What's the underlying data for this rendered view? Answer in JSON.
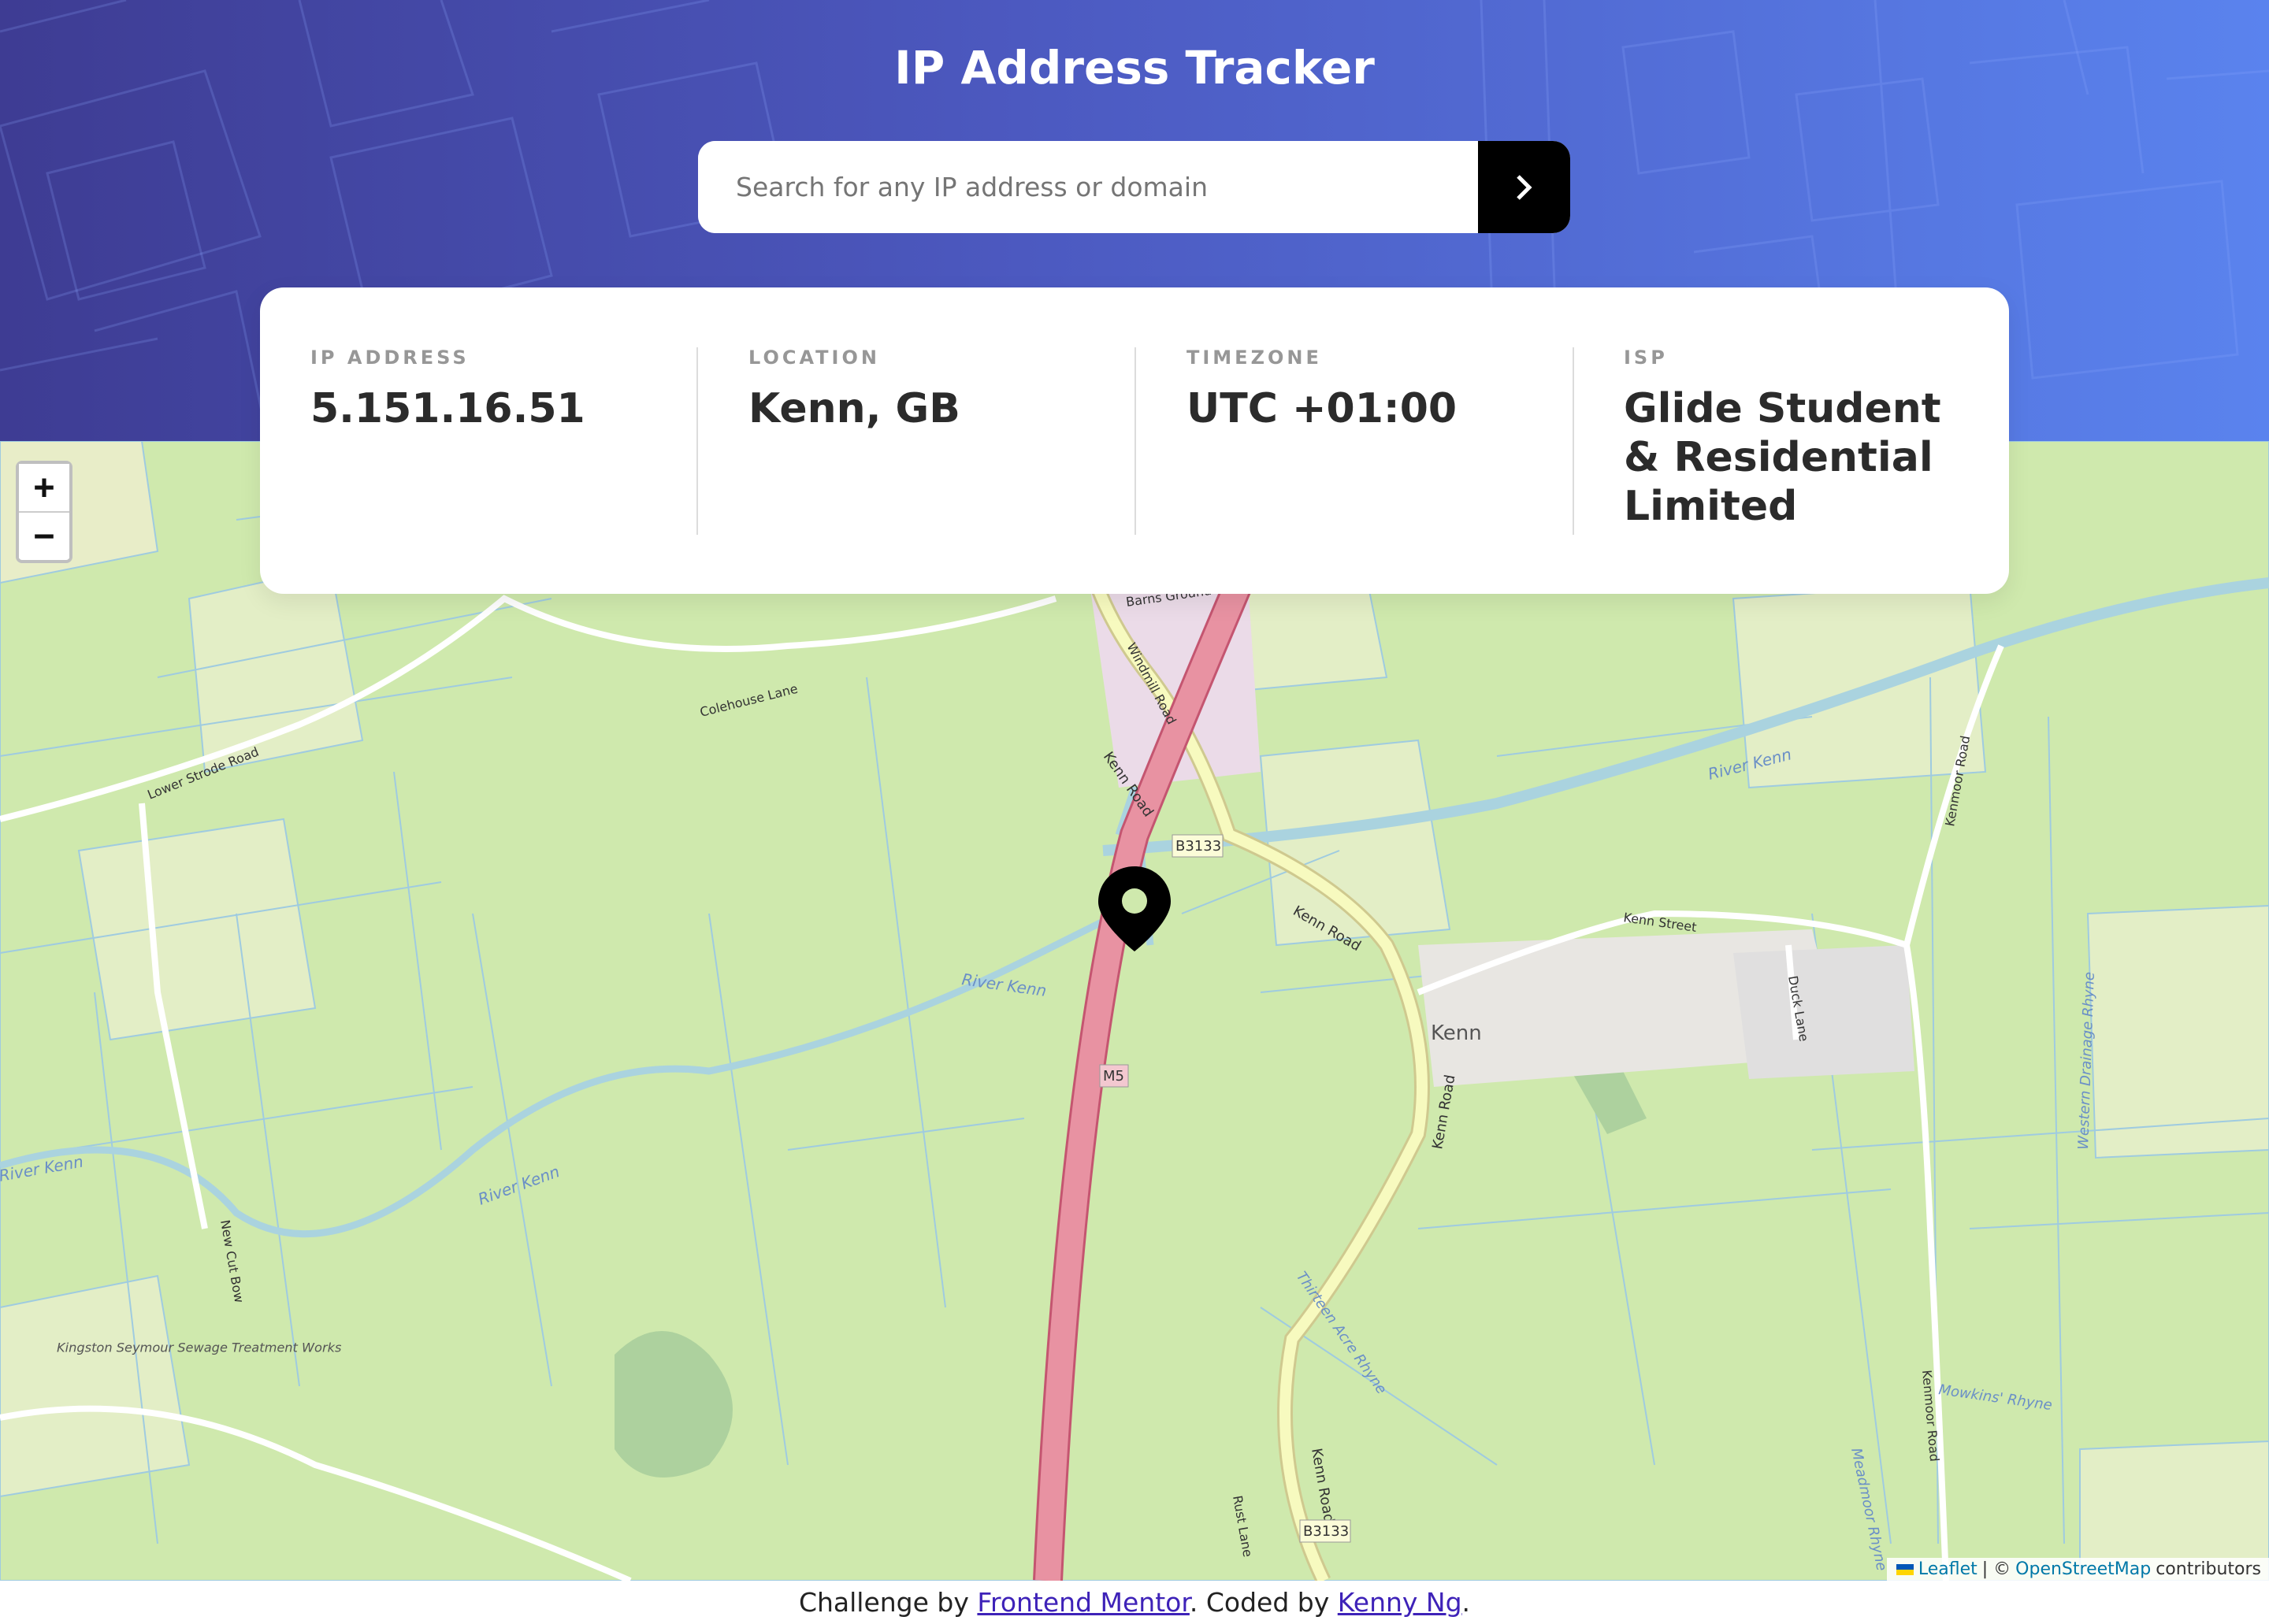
{
  "header": {
    "title": "IP Address Tracker",
    "search_placeholder": "Search for any IP address or domain",
    "search_button_icon": "chevron-right-icon"
  },
  "stats": [
    {
      "label": "IP ADDRESS",
      "value": "5.151.16.51"
    },
    {
      "label": "LOCATION",
      "value": "Kenn, GB"
    },
    {
      "label": "TIMEZONE",
      "value": "UTC +01:00"
    },
    {
      "label": "ISP",
      "value": "Glide Student & Residential Limited"
    }
  ],
  "map": {
    "zoom_in": "+",
    "zoom_out": "−",
    "marker_icon": "location-pin-icon",
    "labels": {
      "kenn": "Kenn",
      "river_kenn": "River Kenn",
      "kenn_road": "Kenn Road",
      "kenn_street": "Kenn Street",
      "b3133": "B3133",
      "m5": "M5",
      "colehouse_lane": "Colehouse Lane",
      "lower_strode_road": "Lower Strode Road",
      "barns_ground": "Barns Ground",
      "windmill_road": "Windmill Road",
      "kenmoor_road": "Kenmoor Road",
      "duck_lane": "Duck Lane",
      "new_cut_bow": "New Cut Bow",
      "thirteen_acre_rhyne": "Thirteen Acre Rhyne",
      "mowkins_rhyne": "Mowkins' Rhyne",
      "meadmoor_rhyne": "Meadmoor Rhyne",
      "western_drainage_rhyne": "Western Drainage Rhyne",
      "rust_lane": "Rust Lane",
      "treatment_works": "Kingston Seymour Sewage Treatment Works"
    }
  },
  "attribution": {
    "leaflet": "Leaflet",
    "separator": "| ©",
    "osm": "OpenStreetMap",
    "contributors": "contributors"
  },
  "footer": {
    "prefix": "Challenge by",
    "fm_link": "Frontend Mentor",
    "middle": ". Coded by",
    "author_link": "Kenny Ng",
    "suffix": "."
  },
  "colors": {
    "header_start": "#3e3c93",
    "header_end": "#5a83ee",
    "map_field": "#cfe9ad",
    "motorway": "#e892a2",
    "road_yellow": "#f7fabf",
    "water": "#aad3df",
    "link": "#3e22b8"
  }
}
